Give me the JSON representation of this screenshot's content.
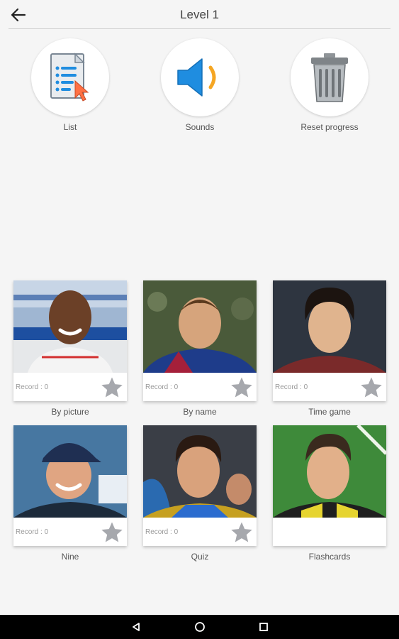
{
  "header": {
    "title": "Level 1"
  },
  "options": [
    {
      "label": "List",
      "icon": "list-icon"
    },
    {
      "label": "Sounds",
      "icon": "speaker-icon"
    },
    {
      "label": "Reset progress",
      "icon": "trash-icon"
    }
  ],
  "modes": [
    {
      "label": "By picture",
      "record": "Record : 0"
    },
    {
      "label": "By name",
      "record": "Record : 0"
    },
    {
      "label": "Time game",
      "record": "Record : 0"
    },
    {
      "label": "Nine",
      "record": "Record : 0"
    },
    {
      "label": "Quiz",
      "record": "Record : 0"
    },
    {
      "label": "Flashcards"
    }
  ],
  "colors": {
    "background": "#f5f5f5",
    "accent_blue": "#1f8de0",
    "accent_orange": "#f5a623",
    "star_gray": "#a6a8ad"
  }
}
